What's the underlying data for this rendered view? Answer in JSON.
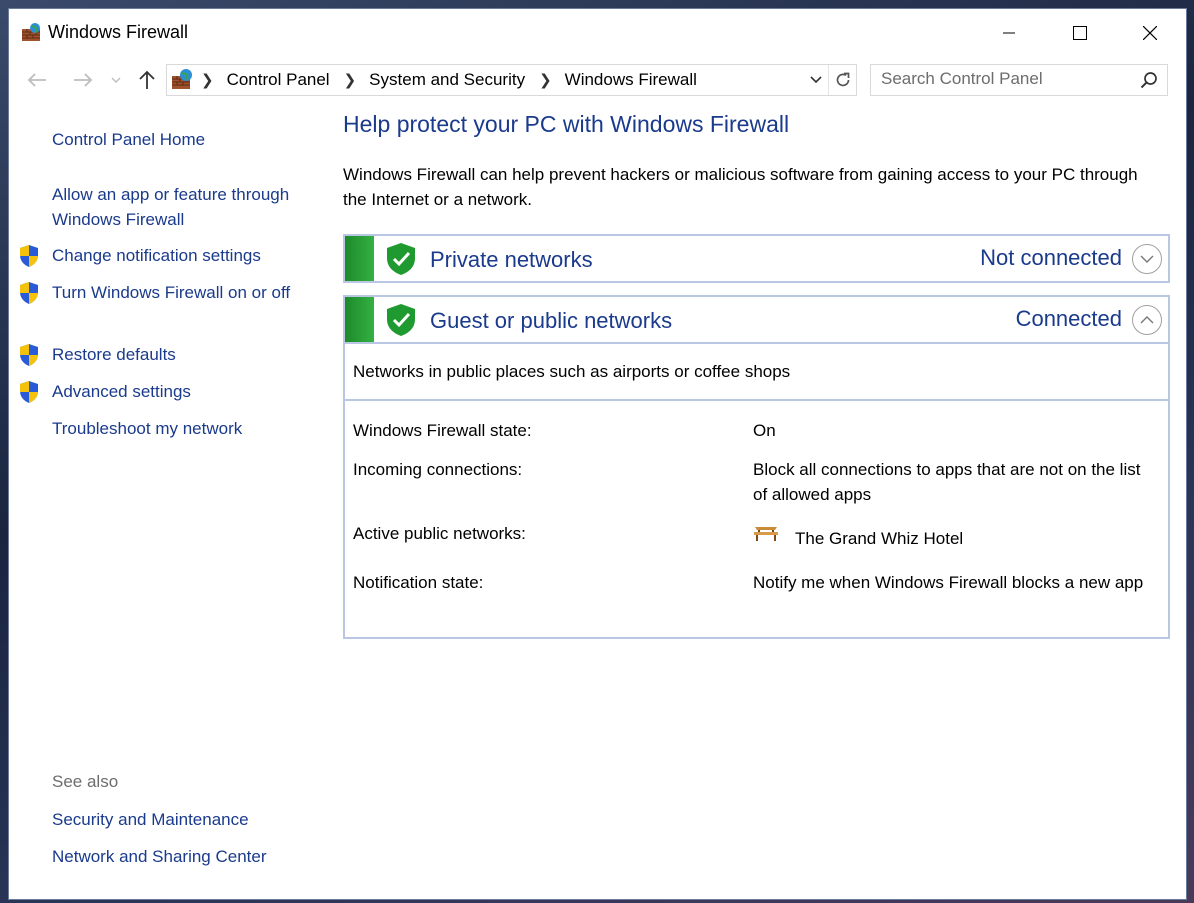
{
  "window": {
    "title": "Windows Firewall",
    "controls": {
      "minimize": "minimize",
      "maximize": "maximize",
      "close": "close"
    }
  },
  "address_bar": {
    "breadcrumbs": [
      "Control Panel",
      "System and Security",
      "Windows Firewall"
    ],
    "search_placeholder": "Search Control Panel"
  },
  "sidebar": {
    "home": "Control Panel Home",
    "links": [
      {
        "label": "Allow an app or feature through Windows Firewall",
        "shield": false
      },
      {
        "label": "Change notification settings",
        "shield": true
      },
      {
        "label": "Turn Windows Firewall on or off",
        "shield": true
      },
      {
        "label": "Restore defaults",
        "shield": true
      },
      {
        "label": "Advanced settings",
        "shield": true
      },
      {
        "label": "Troubleshoot my network",
        "shield": false
      }
    ],
    "see_also": {
      "heading": "See also",
      "links": [
        "Security and Maintenance",
        "Network and Sharing Center"
      ]
    }
  },
  "main": {
    "heading": "Help protect your PC with Windows Firewall",
    "intro": "Windows Firewall can help prevent hackers or malicious software from gaining access to your PC through the Internet or a network.",
    "private": {
      "title": "Private networks",
      "status": "Not connected",
      "expanded": false
    },
    "public": {
      "title": "Guest or public networks",
      "status": "Connected",
      "expanded": true,
      "description": "Networks in public places such as airports or coffee shops",
      "details": {
        "state_label": "Windows Firewall state:",
        "state_value": "On",
        "incoming_label": "Incoming connections:",
        "incoming_value": "Block all connections to apps that are not on the list of allowed apps",
        "active_label": "Active public networks:",
        "active_value": "The Grand Whiz Hotel",
        "notification_label": "Notification state:",
        "notification_value": "Notify me when Windows Firewall blocks a new app"
      }
    }
  },
  "colors": {
    "link": "#1a3a8c",
    "panel_border": "#b9c6e4",
    "status_green": "#1d8a2a",
    "shield_blue": "#2a5bd7",
    "shield_yellow": "#f4c20d"
  }
}
